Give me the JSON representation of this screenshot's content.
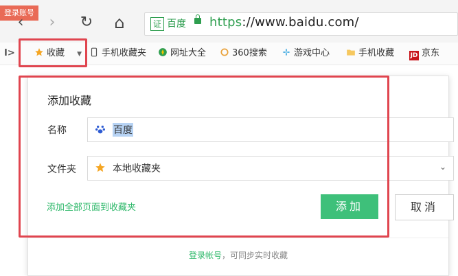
{
  "toolbar": {
    "login_badge": "登录账号",
    "back_icon": "‹",
    "forward_icon": "›",
    "reload_icon": "↻",
    "home_icon": "⌂",
    "address": {
      "cert_label": "证",
      "site_name": "百度",
      "url_scheme": "https",
      "url_rest": "://www.baidu.com/"
    }
  },
  "bookmarks_bar": {
    "toggle": "I>",
    "items": [
      {
        "label": "收藏",
        "icon": "star-icon",
        "has_dropdown": true
      },
      {
        "label": "手机收藏夹",
        "icon": "phone-icon"
      },
      {
        "label": "网址大全",
        "icon": "compass-icon"
      },
      {
        "label": "360搜索",
        "icon": "search-360-icon"
      },
      {
        "label": "游戏中心",
        "icon": "gamepad-icon"
      },
      {
        "label": "手机收藏",
        "icon": "folder-icon"
      },
      {
        "label": "京东",
        "icon": "jd-icon",
        "icon_text": "JD"
      }
    ]
  },
  "dialog": {
    "title": "添加收藏",
    "name_label": "名称",
    "name_value": "百度",
    "folder_label": "文件夹",
    "folder_value": "本地收藏夹",
    "add_all_link": "添加全部页面到收藏夹",
    "add_button": "添加",
    "cancel_button": "取消",
    "footer_link": "登录帐号",
    "footer_text": "，可同步实时收藏"
  },
  "colors": {
    "accent_green": "#3ec07a",
    "highlight_red": "#e0454f",
    "url_green": "#2e9e4f"
  }
}
